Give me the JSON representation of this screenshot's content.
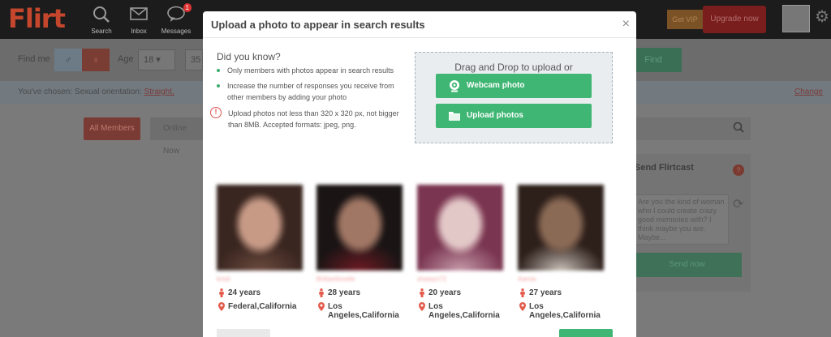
{
  "app": {
    "logo": "Flirt"
  },
  "topnav": {
    "items": [
      {
        "label": "Search",
        "icon": "search-icon"
      },
      {
        "label": "Inbox",
        "icon": "envelope-icon"
      },
      {
        "label": "Messages",
        "icon": "chat-bubble-icon",
        "badge": "1"
      }
    ],
    "upgrade_label": "Upgrade now",
    "promo_label": "Get VIP"
  },
  "filters": {
    "find_me_label": "Find me",
    "age_label": "Age",
    "age_from": "18",
    "age_to": "35",
    "find_label": "Find"
  },
  "chosen": {
    "prefix": "You've chosen:  Sexual orientation: ",
    "value": "Straight,",
    "change_label": "Change"
  },
  "tabs": {
    "all_members": "All Members",
    "online_now": "Online Now"
  },
  "flirtcast": {
    "title": "Send Flirtcast",
    "message": "Are you the kind of woman who I could create crazy good memories with? I think maybe you are. Maybe...",
    "send_label": "Send now"
  },
  "modal": {
    "title": "Upload a photo to appear in search results",
    "close": "×",
    "did_you_know": "Did you know?",
    "bullets": [
      "Only members with photos appear in search results",
      "Increase the number of responses you receive from other members by adding your photo"
    ],
    "warning": "Upload photos not less than 320 x 320 px, not bigger than 8MB. Accepted formats: jpeg, png.",
    "drop_title": "Drag and Drop to upload or",
    "webcam_label": "Webcam photo",
    "upload_label": "Upload photos"
  },
  "members": [
    {
      "name": "kristi",
      "age": "24 years",
      "location": "Federal,California",
      "photo_colors": [
        "#3a2620",
        "#c79a86",
        "#6b4a3e"
      ]
    },
    {
      "name": "Brittanilovelie",
      "age": "28 years",
      "location": "Los Angeles,California",
      "photo_colors": [
        "#1a1414",
        "#a07664",
        "#6e1b24"
      ]
    },
    {
      "name": "shawyn72",
      "age": "20 years",
      "location": "Los Angeles,California",
      "photo_colors": [
        "#7a3550",
        "#e3c8c8",
        "#c59aa9"
      ]
    },
    {
      "name": "Aamie",
      "age": "27 years",
      "location": "Los Angeles,California",
      "photo_colors": [
        "#2d1f1a",
        "#8b6a55",
        "#c9bfb8"
      ]
    }
  ],
  "colors": {
    "accent_green": "#3fb673",
    "warning_red": "#e05151",
    "pin_red": "#e45b4b",
    "name_pink": "#f4a4a4"
  }
}
